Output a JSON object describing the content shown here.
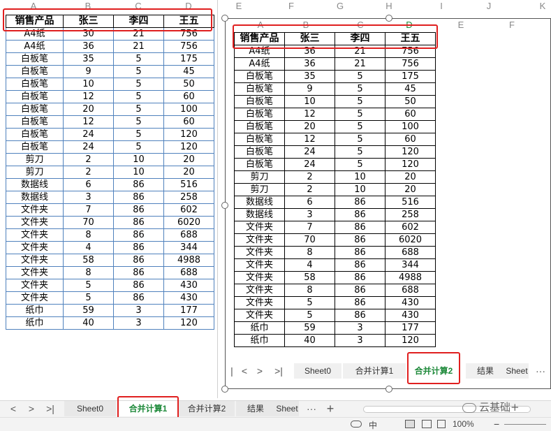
{
  "left_sheet": {
    "col_headers": [
      "A",
      "B",
      "C",
      "D"
    ],
    "headers": [
      "销售产品",
      "张三",
      "李四",
      "王五"
    ],
    "rows": [
      [
        "A4纸",
        "30",
        "21",
        "756"
      ],
      [
        "A4纸",
        "36",
        "21",
        "756"
      ],
      [
        "白板笔",
        "35",
        "5",
        "175"
      ],
      [
        "白板笔",
        "9",
        "5",
        "45"
      ],
      [
        "白板笔",
        "10",
        "5",
        "50"
      ],
      [
        "白板笔",
        "12",
        "5",
        "60"
      ],
      [
        "白板笔",
        "20",
        "5",
        "100"
      ],
      [
        "白板笔",
        "12",
        "5",
        "60"
      ],
      [
        "白板笔",
        "24",
        "5",
        "120"
      ],
      [
        "白板笔",
        "24",
        "5",
        "120"
      ],
      [
        "剪刀",
        "2",
        "10",
        "20"
      ],
      [
        "剪刀",
        "2",
        "10",
        "20"
      ],
      [
        "数据线",
        "6",
        "86",
        "516"
      ],
      [
        "数据线",
        "3",
        "86",
        "258"
      ],
      [
        "文件夹",
        "7",
        "86",
        "602"
      ],
      [
        "文件夹",
        "70",
        "86",
        "6020"
      ],
      [
        "文件夹",
        "8",
        "86",
        "688"
      ],
      [
        "文件夹",
        "4",
        "86",
        "344"
      ],
      [
        "文件夹",
        "58",
        "86",
        "4988"
      ],
      [
        "文件夹",
        "8",
        "86",
        "688"
      ],
      [
        "文件夹",
        "5",
        "86",
        "430"
      ],
      [
        "文件夹",
        "5",
        "86",
        "430"
      ],
      [
        "纸巾",
        "59",
        "3",
        "177"
      ],
      [
        "纸巾",
        "40",
        "3",
        "120"
      ]
    ]
  },
  "right_sheet": {
    "outer_col_headers": [
      "E",
      "F",
      "G",
      "H",
      "I",
      "J",
      "K"
    ],
    "col_headers": [
      "A",
      "B",
      "C",
      "D",
      "E",
      "F"
    ],
    "headers": [
      "销售产品",
      "张三",
      "李四",
      "王五"
    ],
    "rows": [
      [
        "A4纸",
        "36",
        "21",
        "756"
      ],
      [
        "A4纸",
        "36",
        "21",
        "756"
      ],
      [
        "白板笔",
        "35",
        "5",
        "175"
      ],
      [
        "白板笔",
        "9",
        "5",
        "45"
      ],
      [
        "白板笔",
        "10",
        "5",
        "50"
      ],
      [
        "白板笔",
        "12",
        "5",
        "60"
      ],
      [
        "白板笔",
        "20",
        "5",
        "100"
      ],
      [
        "白板笔",
        "12",
        "5",
        "60"
      ],
      [
        "白板笔",
        "24",
        "5",
        "120"
      ],
      [
        "白板笔",
        "24",
        "5",
        "120"
      ],
      [
        "剪刀",
        "2",
        "10",
        "20"
      ],
      [
        "剪刀",
        "2",
        "10",
        "20"
      ],
      [
        "数据线",
        "6",
        "86",
        "516"
      ],
      [
        "数据线",
        "3",
        "86",
        "258"
      ],
      [
        "文件夹",
        "7",
        "86",
        "602"
      ],
      [
        "文件夹",
        "70",
        "86",
        "6020"
      ],
      [
        "文件夹",
        "8",
        "86",
        "688"
      ],
      [
        "文件夹",
        "4",
        "86",
        "344"
      ],
      [
        "文件夹",
        "58",
        "86",
        "4988"
      ],
      [
        "文件夹",
        "8",
        "86",
        "688"
      ],
      [
        "文件夹",
        "5",
        "86",
        "430"
      ],
      [
        "文件夹",
        "5",
        "86",
        "430"
      ],
      [
        "纸巾",
        "59",
        "3",
        "177"
      ],
      [
        "纸巾",
        "40",
        "3",
        "120"
      ]
    ],
    "tabs": [
      "Sheet0",
      "合并计算1",
      "合并计算2",
      "结果",
      "Sheet"
    ],
    "active_tab": "合并计算2",
    "more": "···"
  },
  "main_tabs": {
    "tabs": [
      "Sheet0",
      "合并计算1",
      "合并计算2",
      "结果",
      "Sheet"
    ],
    "active_tab": "合并计算1",
    "more": "···",
    "add": "+"
  },
  "status_bar": {
    "lang": "中",
    "zoom": "100%",
    "zoom_minus": "−"
  },
  "watermark": "云基础+",
  "accent_color": "#1f8a3b",
  "highlight_color": "#e01f1f",
  "nav_arrows": [
    "<",
    ">",
    ">|"
  ]
}
